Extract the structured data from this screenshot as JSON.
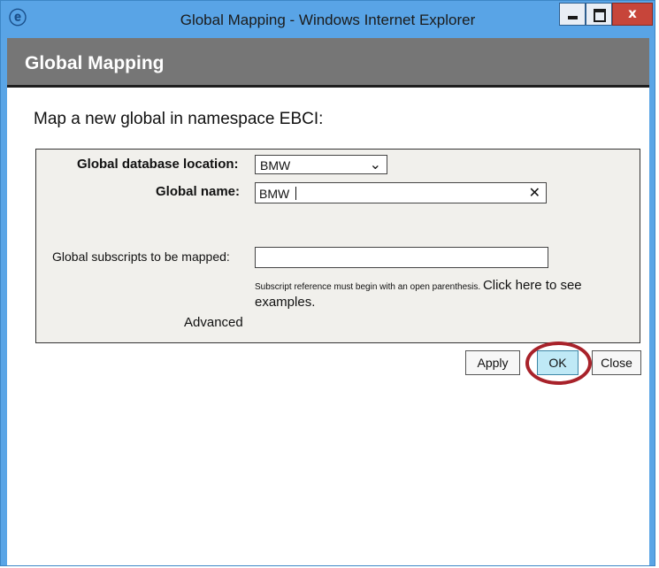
{
  "window": {
    "title": "Global Mapping - Windows Internet Explorer",
    "app_icon": "internet-explorer-icon",
    "controls": [
      "minimize-icon",
      "maximize-icon",
      "close-icon"
    ]
  },
  "header": {
    "title": "Global Mapping"
  },
  "page": {
    "subtitle": "Map a new global in namespace EBCI:"
  },
  "form": {
    "db_location_label": "Global database location:",
    "db_location_value": "BMW",
    "global_name_label": "Global name:",
    "global_name_value": "BMW",
    "subscripts_label": "Global subscripts to be mapped:",
    "subscripts_value": "",
    "hint_text": "Subscript reference must begin with an open parenthesis.",
    "hint_link": "Click here to see examples.",
    "advanced_label": "Advanced"
  },
  "buttons": {
    "apply": "Apply",
    "ok": "OK",
    "close": "Close"
  },
  "colors": {
    "titlebar": "#59a4e6",
    "header_bar": "#767676",
    "ok_button": "#bfe9f6",
    "highlight_ring": "#a8222a"
  }
}
